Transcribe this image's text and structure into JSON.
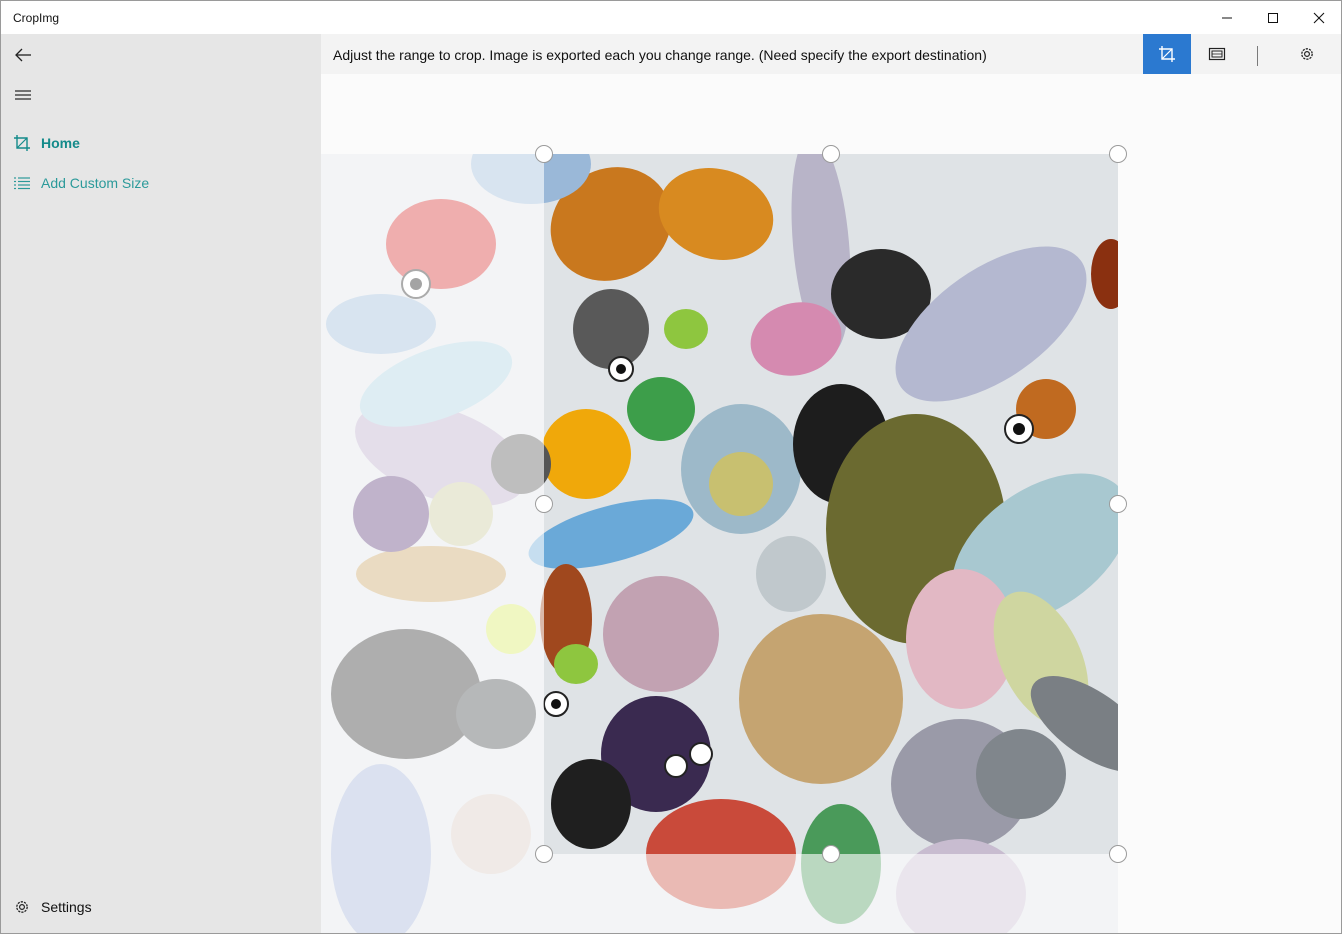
{
  "app": {
    "title": "CropImg"
  },
  "titlebar": {
    "minimize_icon": "minimize-icon",
    "maximize_icon": "maximize-icon",
    "close_icon": "close-icon"
  },
  "sidebar": {
    "back_icon": "back-arrow-icon",
    "menu_icon": "hamburger-icon",
    "items": [
      {
        "label": "Home",
        "icon": "crop-icon",
        "selected": true
      },
      {
        "label": "Add Custom Size",
        "icon": "list-icon",
        "selected": false
      }
    ],
    "settings": {
      "label": "Settings",
      "icon": "gear-icon"
    }
  },
  "command_bar": {
    "hint": "Adjust the range to crop. Image is exported each you change range. (Need specify the export destination)",
    "buttons": [
      {
        "name": "crop",
        "icon": "crop-icon",
        "active": true
      },
      {
        "name": "export",
        "icon": "export-image-icon",
        "active": false
      },
      {
        "name": "settings",
        "icon": "gear-icon",
        "active": false
      }
    ]
  },
  "colors": {
    "accent": "#2b79d0",
    "nav_text": "#138a8a",
    "sidebar_bg": "#e6e6e6"
  }
}
